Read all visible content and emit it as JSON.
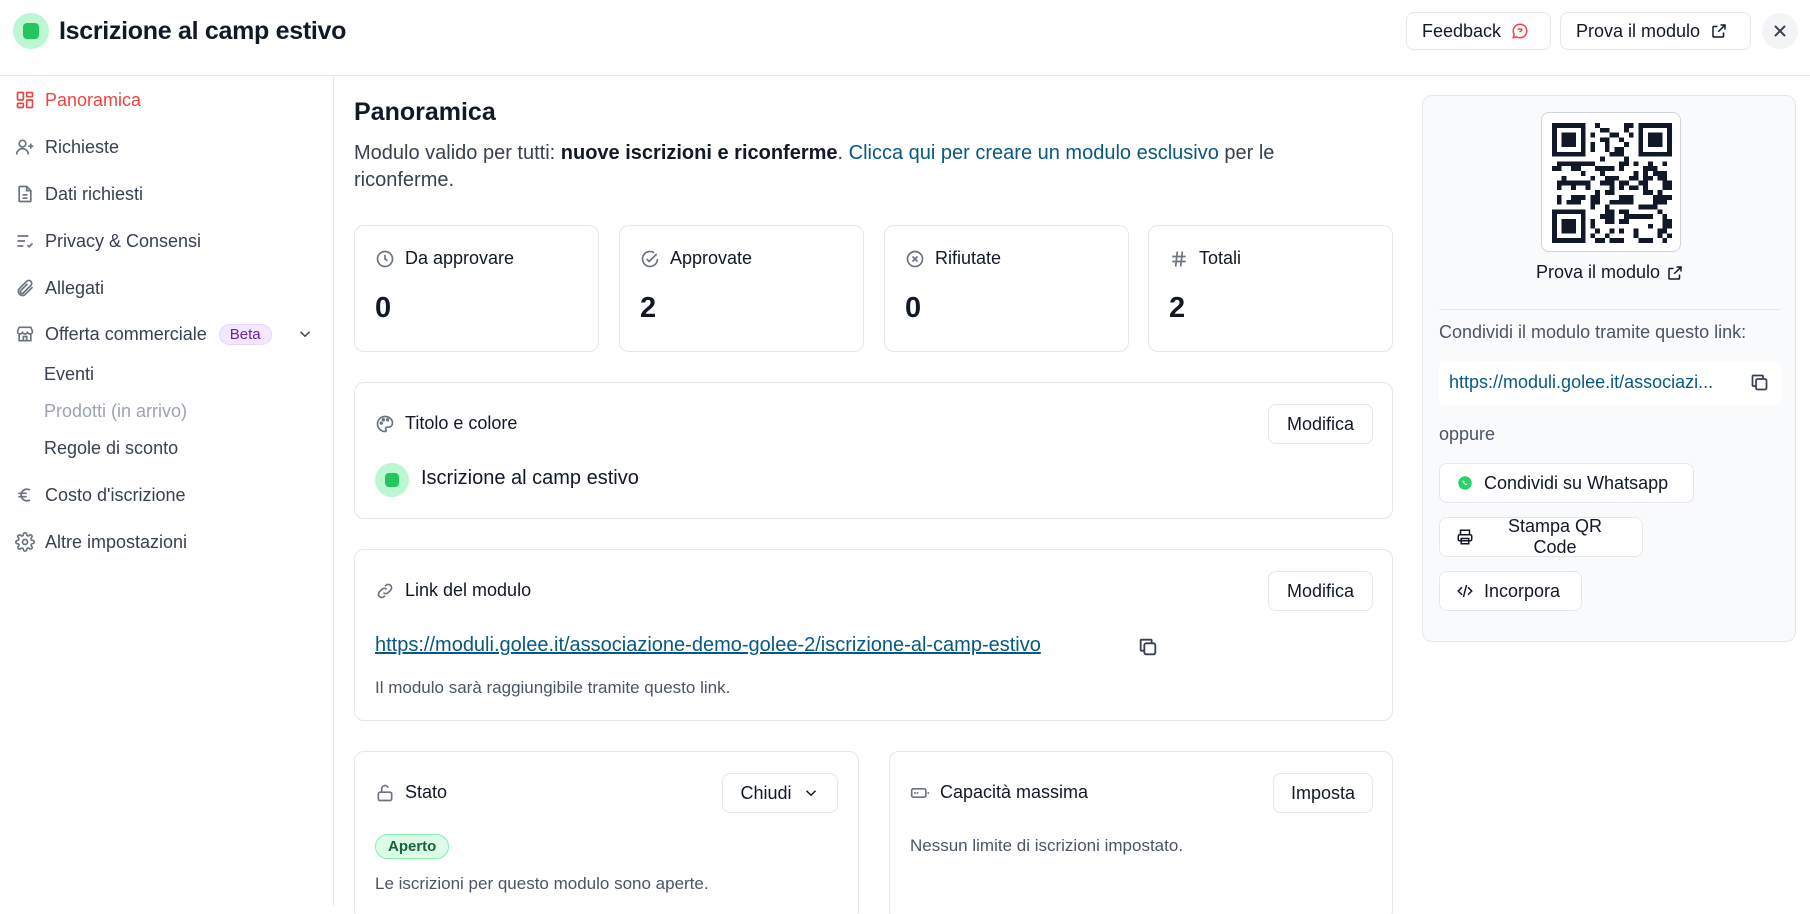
{
  "header": {
    "title": "Iscrizione al camp estivo",
    "feedback_label": "Feedback",
    "try_label": "Prova il modulo"
  },
  "sidebar": {
    "items": [
      {
        "label": "Panoramica",
        "icon": "dashboard-icon"
      },
      {
        "label": "Richieste",
        "icon": "user-plus-icon"
      },
      {
        "label": "Dati richiesti",
        "icon": "document-icon"
      },
      {
        "label": "Privacy & Consensi",
        "icon": "list-check-icon"
      },
      {
        "label": "Allegati",
        "icon": "paperclip-icon"
      },
      {
        "label": "Offerta commerciale",
        "icon": "store-icon",
        "badge": "Beta"
      },
      {
        "label": "Costo d'iscrizione",
        "icon": "euro-icon"
      },
      {
        "label": "Altre impostazioni",
        "icon": "gear-icon"
      }
    ],
    "subitems": [
      {
        "label": "Eventi"
      },
      {
        "label": "Prodotti (in arrivo)"
      },
      {
        "label": "Regole di sconto"
      }
    ]
  },
  "main": {
    "title": "Panoramica",
    "desc_prefix": "Modulo valido per tutti: ",
    "desc_bold": "nuove iscrizioni e riconferme",
    "desc_dot": ". ",
    "desc_link": "Clicca qui per creare un modulo esclusivo",
    "desc_suffix": " per le riconferme.",
    "stats": [
      {
        "label": "Da approvare",
        "value": "0"
      },
      {
        "label": "Approvate",
        "value": "2"
      },
      {
        "label": "Rifiutate",
        "value": "0"
      },
      {
        "label": "Totali",
        "value": "2"
      }
    ],
    "title_card": {
      "heading": "Titolo e colore",
      "edit_label": "Modifica",
      "form_name": "Iscrizione al camp estivo"
    },
    "link_card": {
      "heading": "Link del modulo",
      "edit_label": "Modifica",
      "url": "https://moduli.golee.it/associazione-demo-golee-2/iscrizione-al-camp-estivo",
      "hint": "Il modulo sarà raggiungibile tramite questo link."
    },
    "status_card": {
      "heading": "Stato",
      "select_value": "Chiudi",
      "badge": "Aperto",
      "hint": "Le iscrizioni per questo modulo sono aperte."
    },
    "capacity_card": {
      "heading": "Capacità massima",
      "set_label": "Imposta",
      "hint": "Nessun limite di iscrizioni impostato."
    }
  },
  "panel": {
    "try_label": "Prova il modulo",
    "share_label": "Condividi il modulo tramite questo link:",
    "share_url": "https://moduli.golee.it/associazione-demo-golee-2/iscrizione-al-camp-estivo",
    "share_url_display": "https://moduli.golee.it/associazi...",
    "or_label": "oppure",
    "whatsapp_label": "Condividi su Whatsapp",
    "print_label": "Stampa QR Code",
    "embed_label": "Incorpora"
  },
  "colors": {
    "accent": "#ef4444",
    "link": "#075985",
    "form_color": "#22c55e",
    "whatsapp": "#25d366"
  }
}
